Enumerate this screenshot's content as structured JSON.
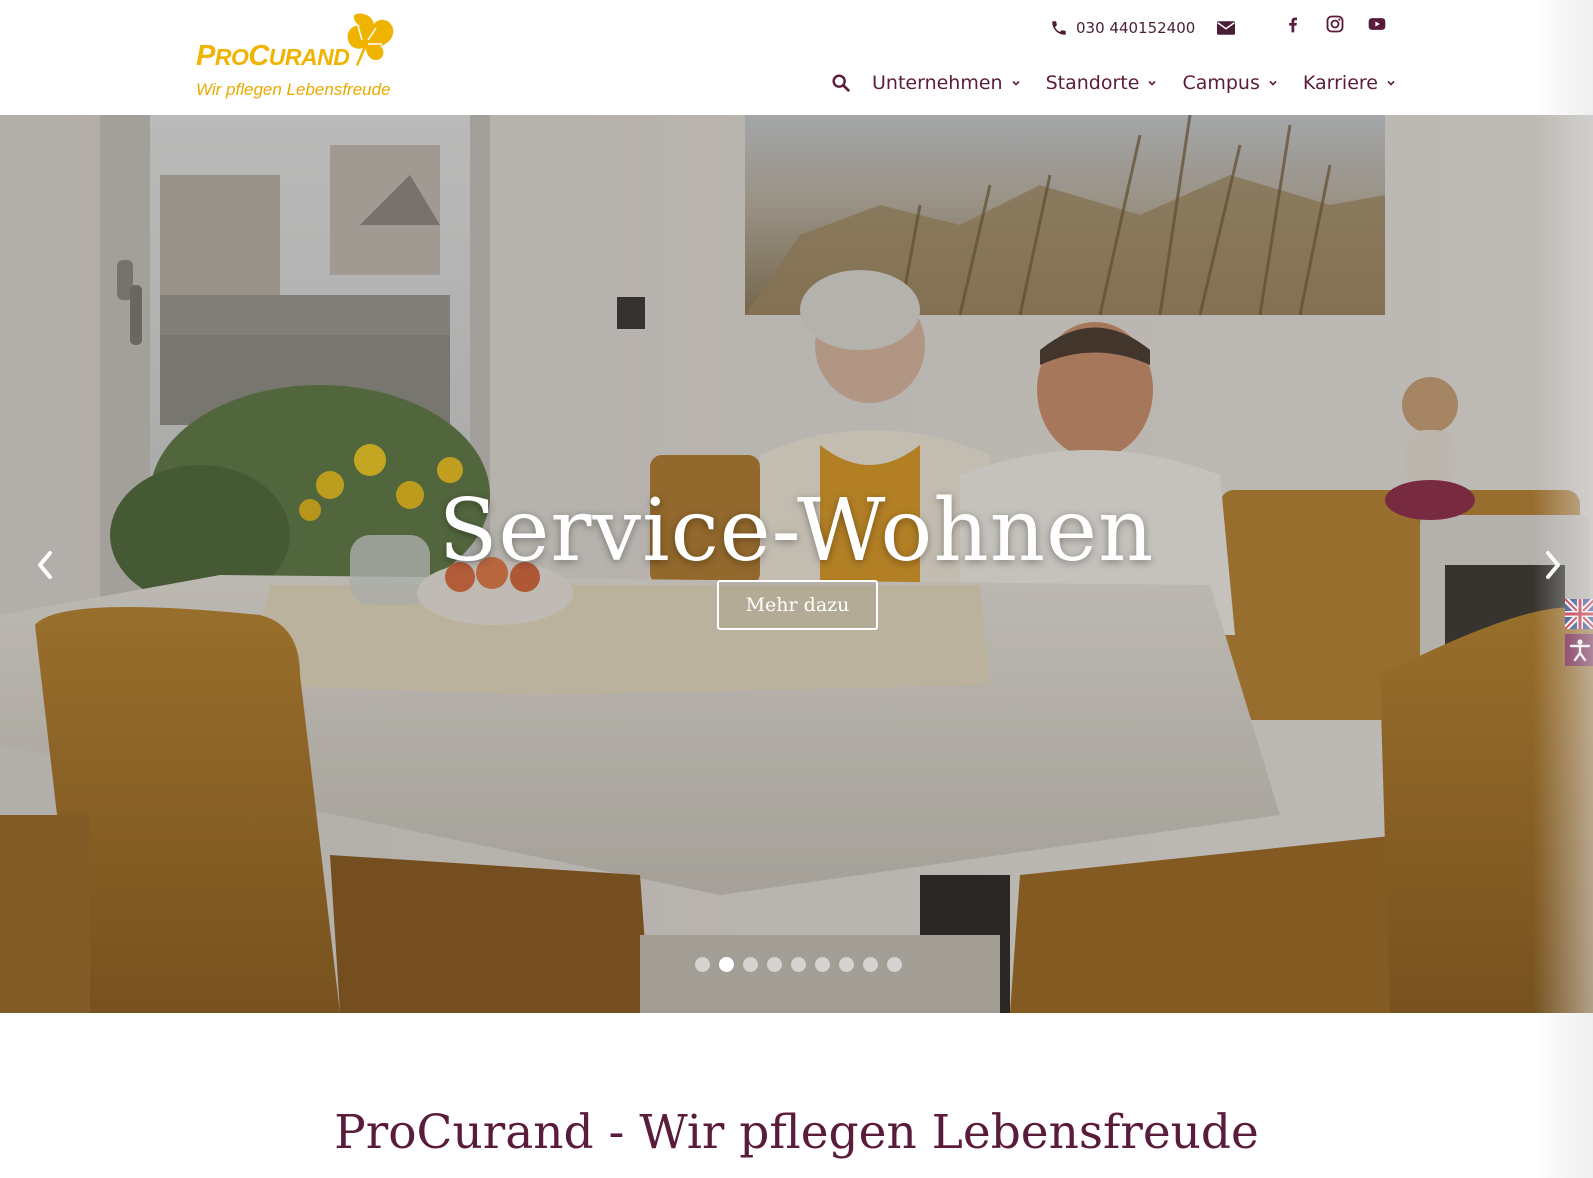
{
  "header": {
    "logo": {
      "wordmark": "ProCurand",
      "tagline": "Wir pflegen Lebensfreude"
    },
    "contact": {
      "phone": "030 440152400"
    },
    "social": [
      "facebook-icon",
      "instagram-icon",
      "youtube-icon"
    ],
    "nav": [
      {
        "label": "Unternehmen"
      },
      {
        "label": "Standorte"
      },
      {
        "label": "Campus"
      },
      {
        "label": "Karriere"
      }
    ]
  },
  "hero": {
    "title": "Service-Wohnen",
    "button_label": "Mehr dazu",
    "slide_count": 9,
    "active_slide_index": 1
  },
  "section": {
    "title": "ProCurand - Wir pflegen Lebensfreude"
  },
  "colors": {
    "brand_primary": "#5b1b3b",
    "brand_yellow": "#f0b400",
    "accessibility_bg": "#6d1844"
  }
}
